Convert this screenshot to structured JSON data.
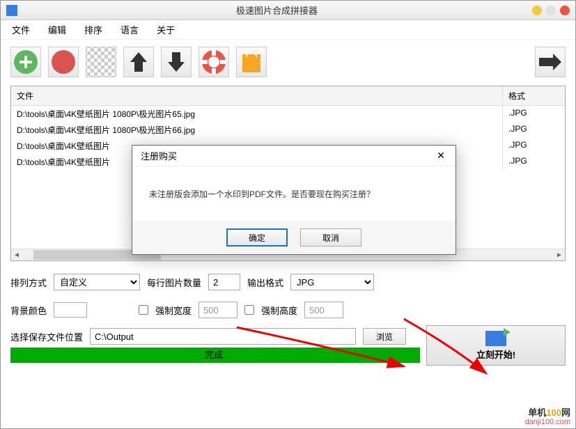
{
  "window": {
    "title": "极速图片合成拼接器"
  },
  "menu": {
    "file": "文件",
    "edit": "编辑",
    "sort": "排序",
    "lang": "语言",
    "about": "关于"
  },
  "toolbar": {
    "add": "add",
    "delete": "delete",
    "clear": "clear",
    "up": "up",
    "down": "down",
    "help": "help",
    "shop": "shop",
    "next": "next"
  },
  "table": {
    "col_file": "文件",
    "col_fmt": "格式",
    "rows": [
      {
        "file": "D:\\tools\\桌面\\4K壁纸图片 1080P\\极光图片65.jpg",
        "fmt": ".JPG"
      },
      {
        "file": "D:\\tools\\桌面\\4K壁纸图片 1080P\\极光图片66.jpg",
        "fmt": ".JPG"
      },
      {
        "file": "D:\\tools\\桌面\\4K壁纸图片",
        "fmt": ".JPG"
      },
      {
        "file": "D:\\tools\\桌面\\4K壁纸图片",
        "fmt": ".JPG"
      }
    ]
  },
  "opts": {
    "layout_label": "排列方式",
    "layout_value": "自定义",
    "perline_label": "每行图片数量",
    "perline_value": "2",
    "outfmt_label": "输出格式",
    "outfmt_value": "JPG",
    "bgcolor_label": "背景颜色",
    "force_w_label": "强制宽度",
    "force_w_value": "500",
    "force_h_label": "强制高度",
    "force_h_value": "500",
    "savepath_label": "选择保存文件位置",
    "savepath_value": "C:\\Output",
    "browse_label": "浏览"
  },
  "progress": {
    "text": "完成."
  },
  "start": {
    "label": "立刻开始!"
  },
  "dialog": {
    "title": "注册购买",
    "message": "未注册版会添加一个水印到PDF文件。是否要现在购买注册？",
    "ok": "确定",
    "cancel": "取消"
  },
  "watermark": {
    "line1": "单机100网",
    "line2": "danji100.com"
  }
}
